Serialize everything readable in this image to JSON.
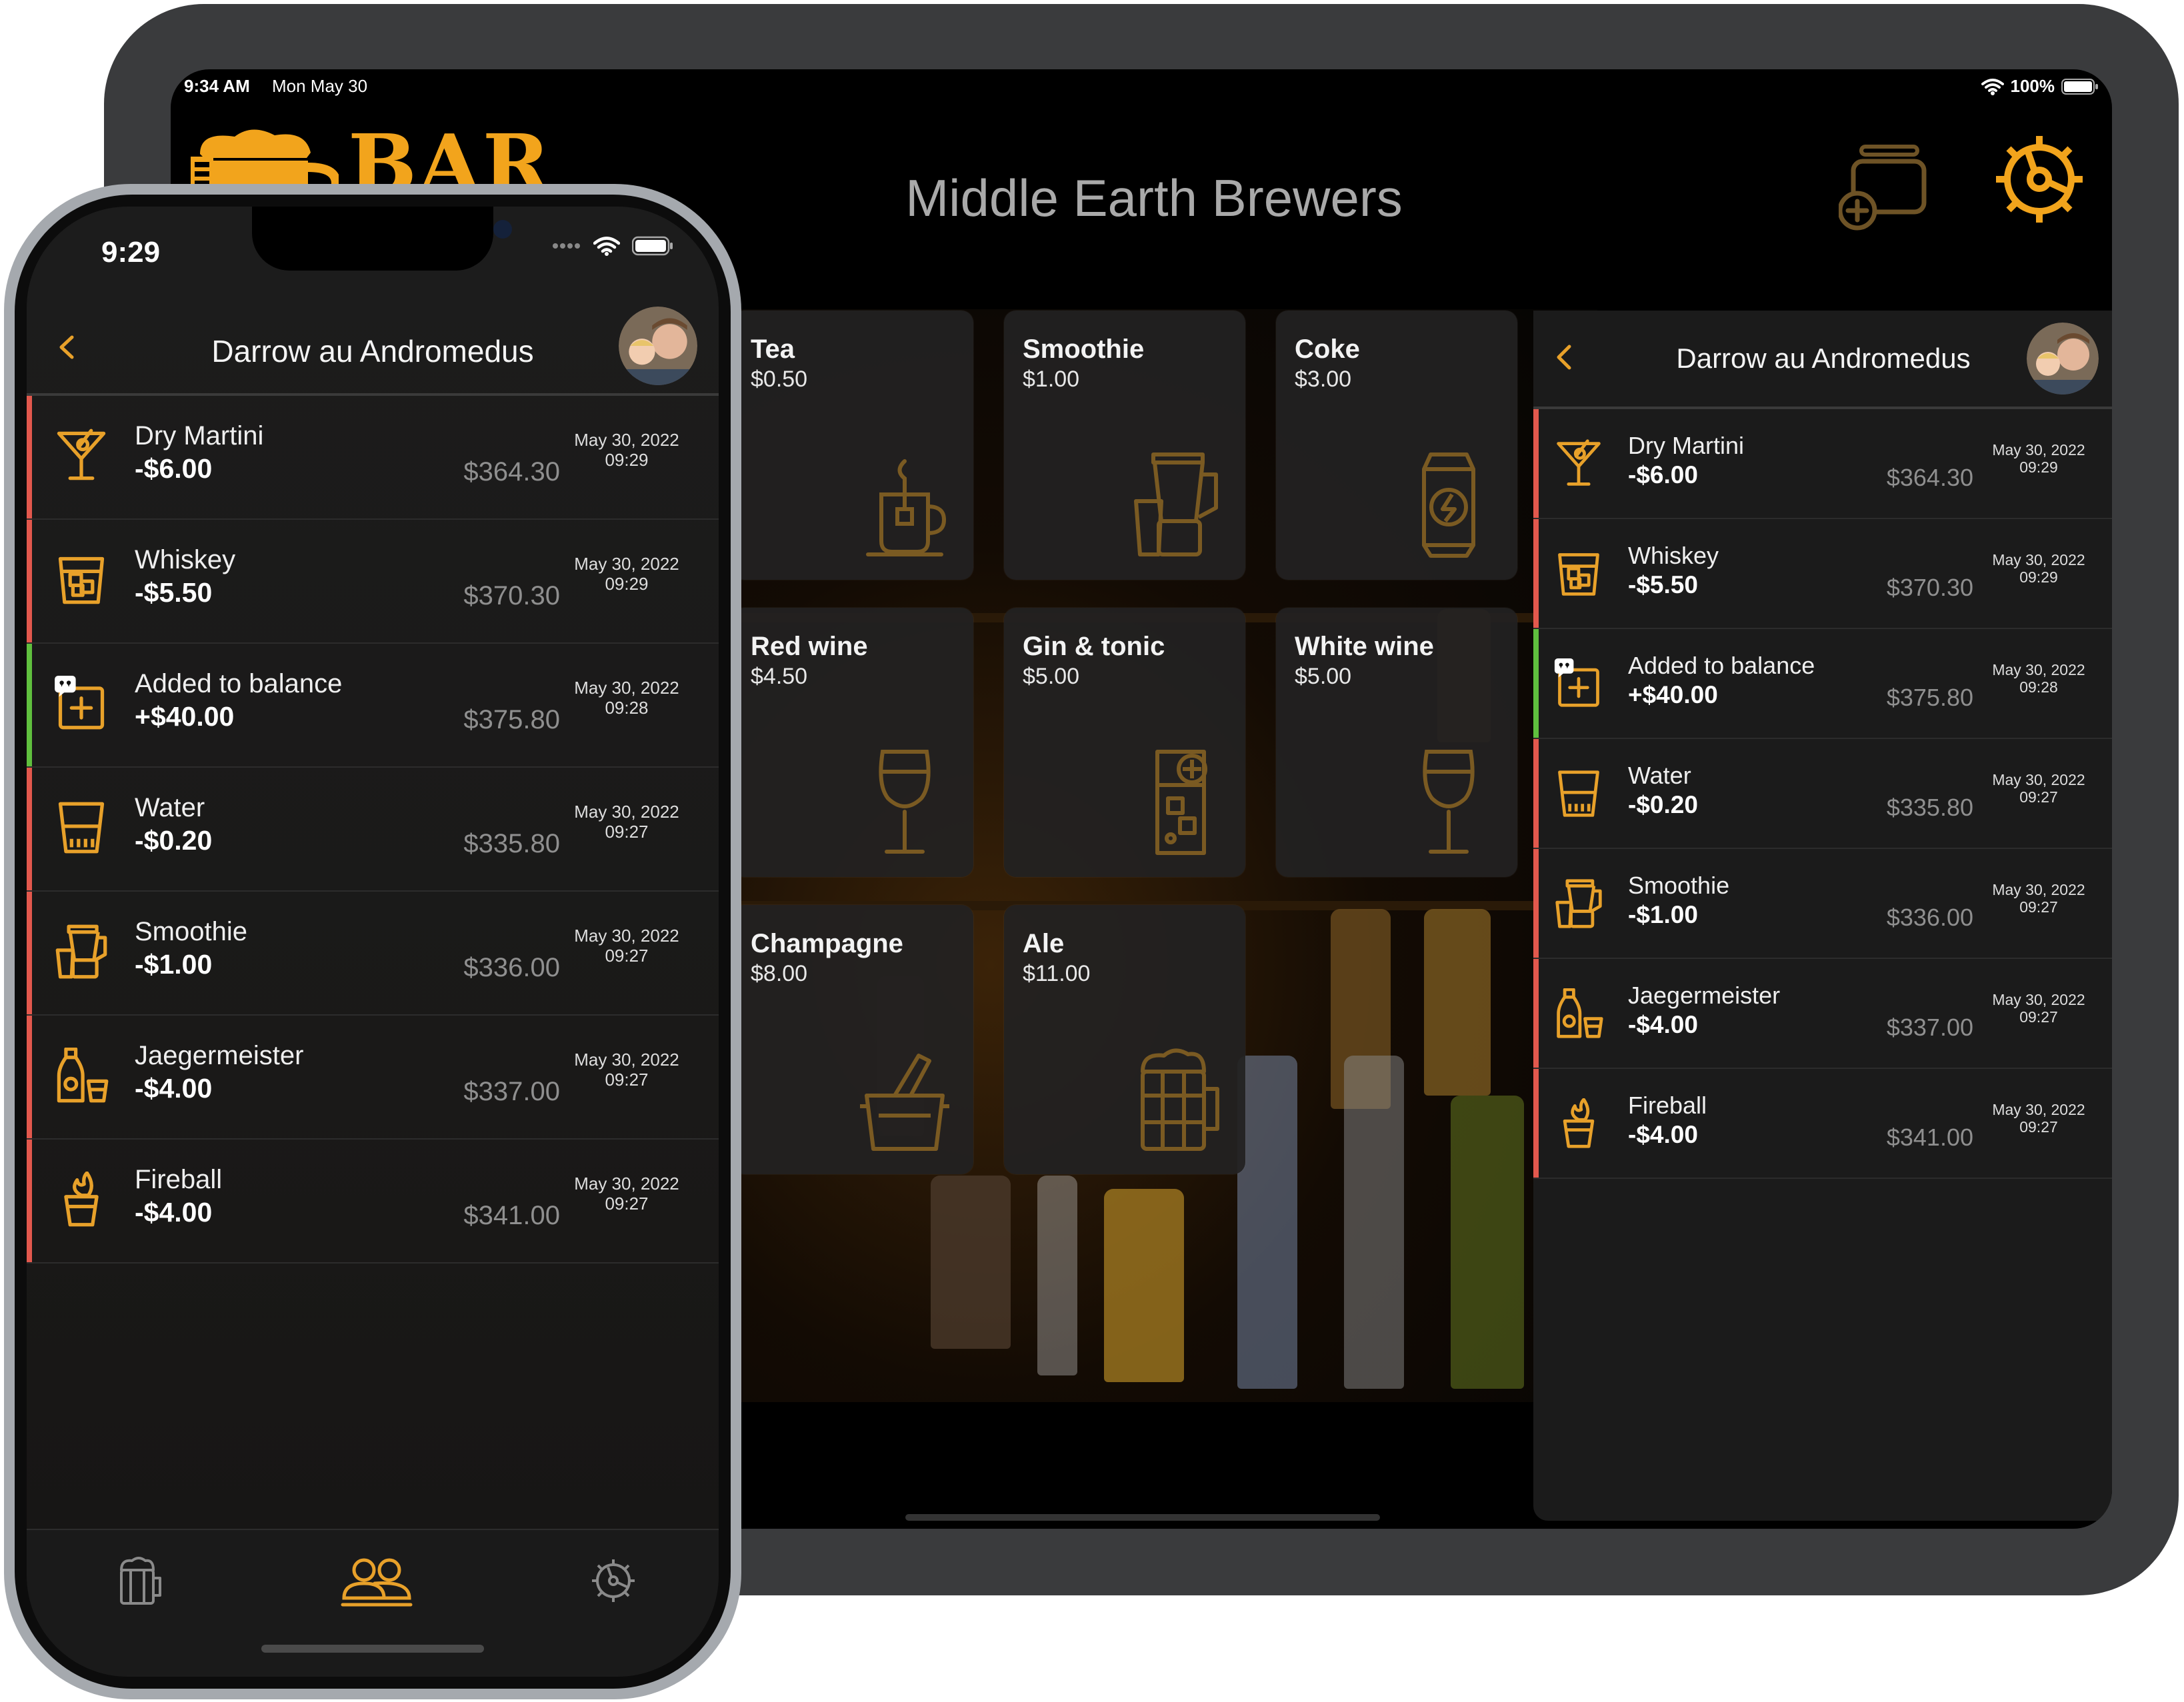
{
  "colors": {
    "accent": "#e8a12a",
    "debit": "#e2584d",
    "credit": "#5fbf3e"
  },
  "ipad": {
    "status": {
      "time": "9:34 AM",
      "date": "Mon May 30",
      "battery": "100%"
    },
    "logo_text": "BAR",
    "title": "Middle Earth Brewers",
    "drinks": [
      {
        "name": "Tea",
        "price": "$0.50",
        "icon": "tea-cup-icon"
      },
      {
        "name": "Smoothie",
        "price": "$1.00",
        "icon": "blender-icon"
      },
      {
        "name": "Coke",
        "price": "$3.00",
        "icon": "soda-can-icon"
      },
      {
        "name": "Red wine",
        "price": "$4.50",
        "icon": "wine-glass-icon"
      },
      {
        "name": "Gin & tonic",
        "price": "$5.00",
        "icon": "highball-glass-icon"
      },
      {
        "name": "White wine",
        "price": "$5.00",
        "icon": "wine-glass-icon"
      },
      {
        "name": "Champagne",
        "price": "$8.00",
        "icon": "ice-bucket-icon"
      },
      {
        "name": "Ale",
        "price": "$11.00",
        "icon": "beer-mug-icon"
      }
    ],
    "panel": {
      "user_name": "Darrow au Andromedus",
      "transactions": [
        {
          "name": "Dry Martini",
          "amount": "-$6.00",
          "balance": "$364.30",
          "date": "May 30, 2022",
          "time": "09:29",
          "type": "debit",
          "icon": "martini-icon"
        },
        {
          "name": "Whiskey",
          "amount": "-$5.50",
          "balance": "$370.30",
          "date": "May 30, 2022",
          "time": "09:29",
          "type": "debit",
          "icon": "whiskey-glass-icon"
        },
        {
          "name": "Added to balance",
          "amount": "+$40.00",
          "balance": "$375.80",
          "date": "May 30, 2022",
          "time": "09:28",
          "type": "credit",
          "icon": "add-balance-icon"
        },
        {
          "name": "Water",
          "amount": "-$0.20",
          "balance": "$335.80",
          "date": "May 30, 2022",
          "time": "09:27",
          "type": "debit",
          "icon": "water-glass-icon"
        },
        {
          "name": "Smoothie",
          "amount": "-$1.00",
          "balance": "$336.00",
          "date": "May 30, 2022",
          "time": "09:27",
          "type": "debit",
          "icon": "blender-icon"
        },
        {
          "name": "Jaegermeister",
          "amount": "-$4.00",
          "balance": "$337.00",
          "date": "May 30, 2022",
          "time": "09:27",
          "type": "debit",
          "icon": "bottle-shot-icon"
        },
        {
          "name": "Fireball",
          "amount": "-$4.00",
          "balance": "$341.00",
          "date": "May 30, 2022",
          "time": "09:27",
          "type": "debit",
          "icon": "flaming-shot-icon"
        }
      ]
    }
  },
  "iphone": {
    "status": {
      "time": "9:29"
    },
    "header": {
      "title": "Darrow au Andromedus"
    },
    "transactions": [
      {
        "name": "Dry Martini",
        "amount": "-$6.00",
        "balance": "$364.30",
        "date": "May 30, 2022",
        "time": "09:29",
        "type": "debit",
        "icon": "martini-icon"
      },
      {
        "name": "Whiskey",
        "amount": "-$5.50",
        "balance": "$370.30",
        "date": "May 30, 2022",
        "time": "09:29",
        "type": "debit",
        "icon": "whiskey-glass-icon"
      },
      {
        "name": "Added to balance",
        "amount": "+$40.00",
        "balance": "$375.80",
        "date": "May 30, 2022",
        "time": "09:28",
        "type": "credit",
        "icon": "add-balance-icon"
      },
      {
        "name": "Water",
        "amount": "-$0.20",
        "balance": "$335.80",
        "date": "May 30, 2022",
        "time": "09:27",
        "type": "debit",
        "icon": "water-glass-icon"
      },
      {
        "name": "Smoothie",
        "amount": "-$1.00",
        "balance": "$336.00",
        "date": "May 30, 2022",
        "time": "09:27",
        "type": "debit",
        "icon": "blender-icon"
      },
      {
        "name": "Jaegermeister",
        "amount": "-$4.00",
        "balance": "$337.00",
        "date": "May 30, 2022",
        "time": "09:27",
        "type": "debit",
        "icon": "bottle-shot-icon"
      },
      {
        "name": "Fireball",
        "amount": "-$4.00",
        "balance": "$341.00",
        "date": "May 30, 2022",
        "time": "09:27",
        "type": "debit",
        "icon": "flaming-shot-icon"
      }
    ],
    "tabs": [
      {
        "icon": "beer-mug-icon",
        "selected": false
      },
      {
        "icon": "people-icon",
        "selected": true
      },
      {
        "icon": "gear-icon",
        "selected": false
      }
    ]
  }
}
